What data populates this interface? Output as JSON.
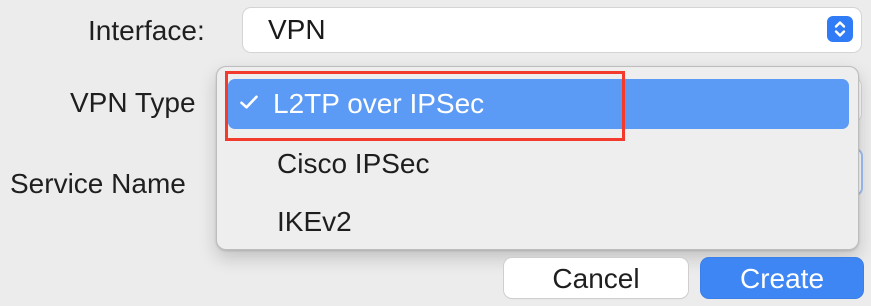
{
  "form": {
    "interface_label": "Interface:",
    "vpn_type_label": "VPN Type",
    "service_name_label": "Service Name",
    "interface_value": "VPN"
  },
  "dropdown": {
    "items": [
      {
        "label": "L2TP over IPSec",
        "selected": true
      },
      {
        "label": "Cisco IPSec",
        "selected": false
      },
      {
        "label": "IKEv2",
        "selected": false
      }
    ]
  },
  "buttons": {
    "cancel": "Cancel",
    "create": "Create"
  },
  "icons": {
    "select_arrows": "up-down-chevron-icon",
    "checkmark": "checkmark-icon"
  },
  "colors": {
    "accent": "#3d86f4",
    "menu_selected": "#5b9af5",
    "highlight": "#f23b2d"
  }
}
